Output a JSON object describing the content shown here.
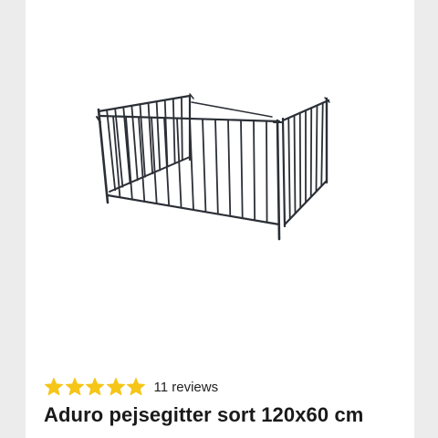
{
  "product": {
    "title": "Aduro pejsegitter sort 120x60 cm",
    "rating": 5,
    "max_rating": 5,
    "reviews_label": "11 reviews",
    "image_icon": "fireplace-guard-image"
  },
  "colors": {
    "background": "#ececec",
    "card": "#ffffff",
    "star": "#f5c518",
    "text": "#1a1a1a",
    "fence": "#2b2f36"
  }
}
